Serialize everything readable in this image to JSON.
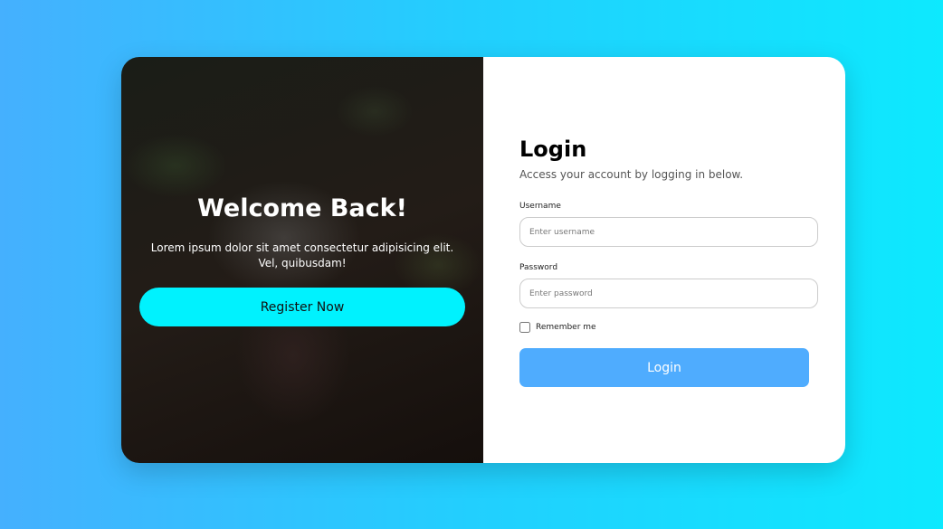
{
  "welcome": {
    "title": "Welcome Back!",
    "text": "Lorem ipsum dolor sit amet consectetur adipisicing elit. Vel, quibusdam!",
    "register_label": "Register Now"
  },
  "login": {
    "title": "Login",
    "subtitle": "Access your account by logging in below.",
    "username_label": "Username",
    "username_placeholder": "Enter username",
    "password_label": "Password",
    "password_placeholder": "Enter password",
    "remember_label": "Remember me",
    "remember_checked": false,
    "submit_label": "Login"
  },
  "colors": {
    "accent": "#4facfe",
    "register": "#00f2fe"
  }
}
